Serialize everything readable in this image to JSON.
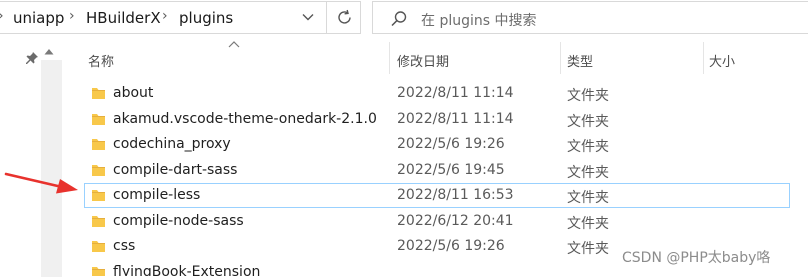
{
  "breadcrumb": {
    "items": [
      "uniapp",
      "HBuilderX",
      "plugins"
    ]
  },
  "search": {
    "placeholder": "在 plugins 中搜索"
  },
  "columns": {
    "name": "名称",
    "date": "修改日期",
    "type": "类型",
    "size": "大小"
  },
  "files": [
    {
      "name": "about",
      "date": "2022/8/11 11:14",
      "type": "文件夹"
    },
    {
      "name": "akamud.vscode-theme-onedark-2.1.0",
      "date": "2022/8/11 11:14",
      "type": "文件夹"
    },
    {
      "name": "codechina_proxy",
      "date": "2022/5/6 19:26",
      "type": "文件夹"
    },
    {
      "name": "compile-dart-sass",
      "date": "2022/5/6 19:45",
      "type": "文件夹"
    },
    {
      "name": "compile-less",
      "date": "2022/8/11 16:53",
      "type": "文件夹",
      "selected": true
    },
    {
      "name": "compile-node-sass",
      "date": "2022/6/12 20:41",
      "type": "文件夹"
    },
    {
      "name": "css",
      "date": "2022/5/6 19:26",
      "type": "文件夹"
    },
    {
      "name": "flyingBook-Extension",
      "date": "",
      "type": ""
    }
  ],
  "colors": {
    "folder": "#f8c84a",
    "folder_dark": "#e1a93a",
    "selection_border": "#99d1ff",
    "annotation_arrow": "#e8322d"
  },
  "icons": {
    "pin": "pin-icon",
    "search": "search-icon",
    "refresh": "refresh-icon",
    "chevron": "chevron-down-icon",
    "folder": "folder-icon"
  },
  "watermark": "CSDN @PHP太baby咯"
}
